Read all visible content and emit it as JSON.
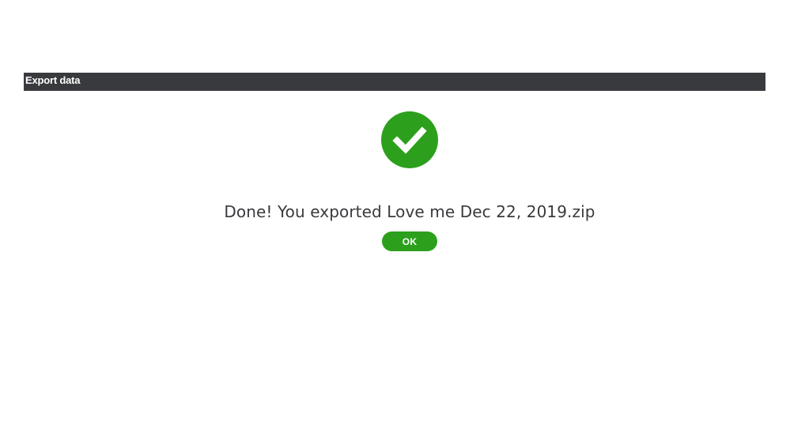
{
  "dialog": {
    "title": "Export data",
    "message": "Done! You exported Love me Dec 22, 2019.zip",
    "ok_label": "OK",
    "icon": "checkmark-circle-icon"
  },
  "colors": {
    "header_bg": "#393a3d",
    "accent_green": "#2ca01c",
    "text": "#393a3d"
  }
}
